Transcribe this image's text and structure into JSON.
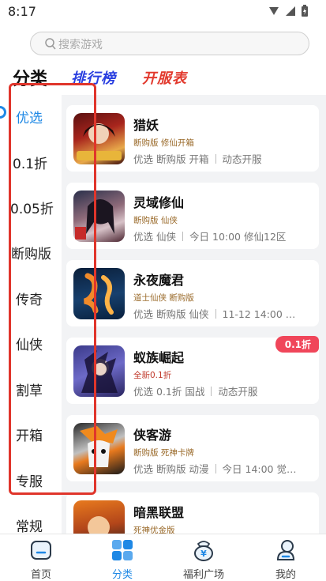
{
  "status_bar": {
    "time": "8:17"
  },
  "search": {
    "placeholder": "搜索游戏"
  },
  "tabs": {
    "category": "分类",
    "ranking": "排行榜",
    "server": "开服表"
  },
  "sidebar": {
    "active_index": 0,
    "items": [
      "优选",
      "0.1折",
      "0.05折",
      "断购版",
      "传奇",
      "仙侠",
      "割草",
      "开箱",
      "专服",
      "常规"
    ]
  },
  "games": [
    {
      "name": "猎妖",
      "tags": "断购版 修仙开箱",
      "meta": [
        "优选",
        "断购版",
        "开箱"
      ],
      "server": "动态开服",
      "badge": ""
    },
    {
      "name": "灵域修仙",
      "tags": "断购版 仙侠",
      "meta": [
        "优选",
        "仙侠"
      ],
      "server": "今日 10:00 修仙12区",
      "badge": ""
    },
    {
      "name": "永夜魔君",
      "tags": "道士仙侠 断购版",
      "meta": [
        "优选",
        "断购版",
        "仙侠"
      ],
      "server": "11-12 14:00 …",
      "badge": ""
    },
    {
      "name": "蚁族崛起",
      "tags": "全新0.1折",
      "meta": [
        "优选",
        "0.1折",
        "国战"
      ],
      "server": "动态开服",
      "badge": "0.1折"
    },
    {
      "name": "侠客游",
      "tags": "断购版 死神卡牌",
      "meta": [
        "优选",
        "断购版",
        "动漫"
      ],
      "server": "今日 14:00 觉…",
      "badge": ""
    },
    {
      "name": "暗黑联盟",
      "tags": "死神优金版",
      "meta": [],
      "server": "",
      "badge": ""
    }
  ],
  "bottom_nav": {
    "active_index": 1,
    "items": [
      {
        "label": "首页",
        "icon": "home-icon"
      },
      {
        "label": "分类",
        "icon": "grid-icon"
      },
      {
        "label": "福利广场",
        "icon": "yen-bag-icon"
      },
      {
        "label": "我的",
        "icon": "profile-icon"
      }
    ]
  },
  "colors": {
    "accent": "#1e88e5",
    "highlight_box": "#e0352b",
    "badge": "#f0465a",
    "ranking_tab": "#2a3fe0",
    "server_tab": "#e23a2e"
  }
}
